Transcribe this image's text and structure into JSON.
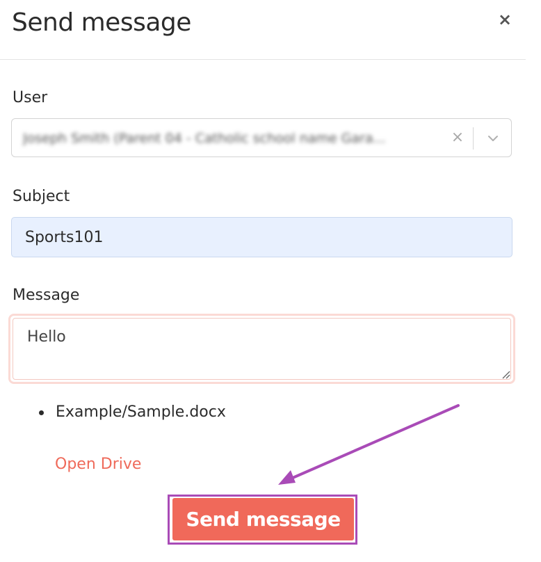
{
  "dialog": {
    "title": "Send message",
    "close_label": "×"
  },
  "user": {
    "label": "User",
    "value": "Joseph Smith (Parent 04 - Catholic school name Gara...",
    "clear_label": "×"
  },
  "subject": {
    "label": "Subject",
    "value": "Sports101"
  },
  "message": {
    "label": "Message",
    "value": "Hello"
  },
  "attachments": [
    {
      "name": "Example/Sample.docx"
    }
  ],
  "open_drive_label": "Open Drive",
  "send_label": "Send message",
  "colors": {
    "accent": "#f0695a",
    "annotation": "#a94bb7",
    "input_fill": "#e8f0fe"
  }
}
